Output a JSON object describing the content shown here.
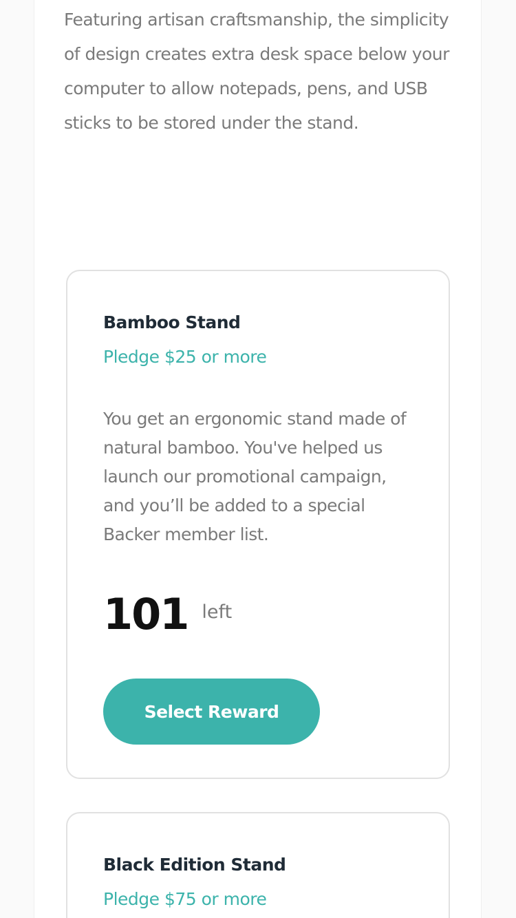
{
  "intro": {
    "text": "Featuring artisan craftsmanship, the simplicity of design creates extra desk space below your computer to allow notepads, pens, and USB sticks to be stored under the stand."
  },
  "rewards": [
    {
      "title": "Bamboo Stand",
      "pledge": "Pledge $25 or more",
      "description": "You get an ergonomic stand made of natural bamboo. You've helped us launch our promotional campaign, and you’ll be added to a special Backer member list.",
      "count": "101",
      "count_label": "left",
      "button_label": "Select Reward"
    },
    {
      "title": "Black Edition Stand",
      "pledge": "Pledge $75 or more"
    }
  ],
  "colors": {
    "accent": "#3cb3ab",
    "heading": "#1f2b36",
    "body_text": "#7a7a7a",
    "card_border": "#e1e1e1",
    "page_background": "#fafafa"
  }
}
